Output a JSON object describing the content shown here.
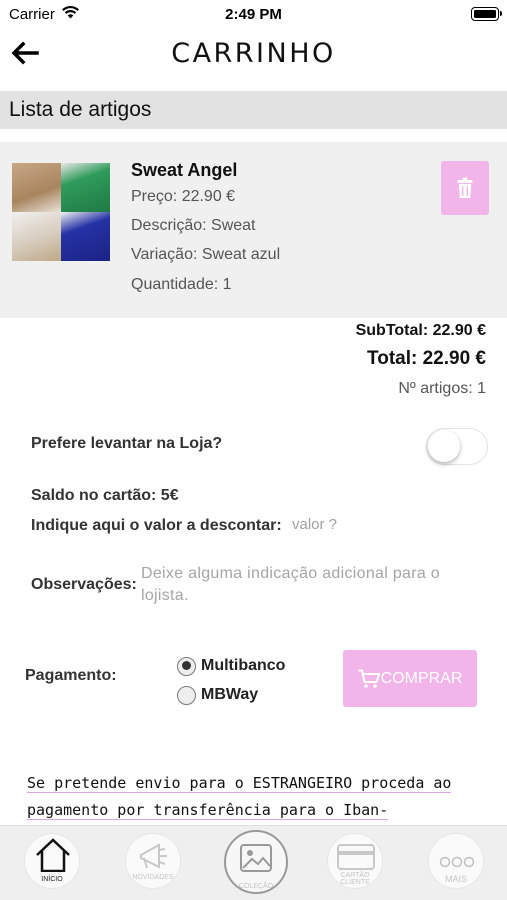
{
  "status_bar": {
    "carrier": "Carrier",
    "time": "2:49 PM"
  },
  "nav": {
    "title": "CARRINHO"
  },
  "list": {
    "heading": "Lista de artigos"
  },
  "item": {
    "name": "Sweat Angel",
    "price": "Preço: 22.90 €",
    "description": "Descrição: Sweat",
    "variation": "Variação: Sweat azul",
    "quantity": "Quantidade: 1",
    "thumbnail": "sweat-product-photo"
  },
  "totals": {
    "subtotal": "SubTotal: 22.90 €",
    "total": "Total: 22.90 €",
    "count": "Nº artigos: 1"
  },
  "pickup": {
    "label": "Prefere levantar na Loja?",
    "enabled": false
  },
  "balance": {
    "label": "Saldo no cartão: 5€"
  },
  "discount": {
    "label": "Indique aqui o valor a descontar:",
    "placeholder": "valor ?"
  },
  "observations": {
    "label": "Observações:",
    "placeholder": "Deixe alguma indicação adicional para o lojista."
  },
  "payment": {
    "label": "Pagamento:",
    "options": [
      "Multibanco",
      "MBWay"
    ],
    "selected": "Multibanco",
    "buy_label": "COMPRAR"
  },
  "notice": {
    "line1": "Se pretende envio para o ESTRANGEIRO proceda ao",
    "line2": "pagamento por transferência para o Iban-"
  },
  "tabbar": {
    "tabs": [
      {
        "label": "INÍCIO",
        "icon": "home-icon",
        "active": true
      },
      {
        "label": "NOVIDADES",
        "icon": "megaphone-icon",
        "active": false
      },
      {
        "label": "COLEÇÃO",
        "icon": "image-icon",
        "active": false
      },
      {
        "label": "CARTÃO CLIENTE",
        "icon": "card-icon",
        "active": false
      },
      {
        "label": "MAIS",
        "icon": "more-icon",
        "active": false
      }
    ]
  },
  "colors": {
    "accent": "#f2b5ea",
    "section_bg": "#e2e2e2",
    "card_bg": "#f0f0f0"
  }
}
